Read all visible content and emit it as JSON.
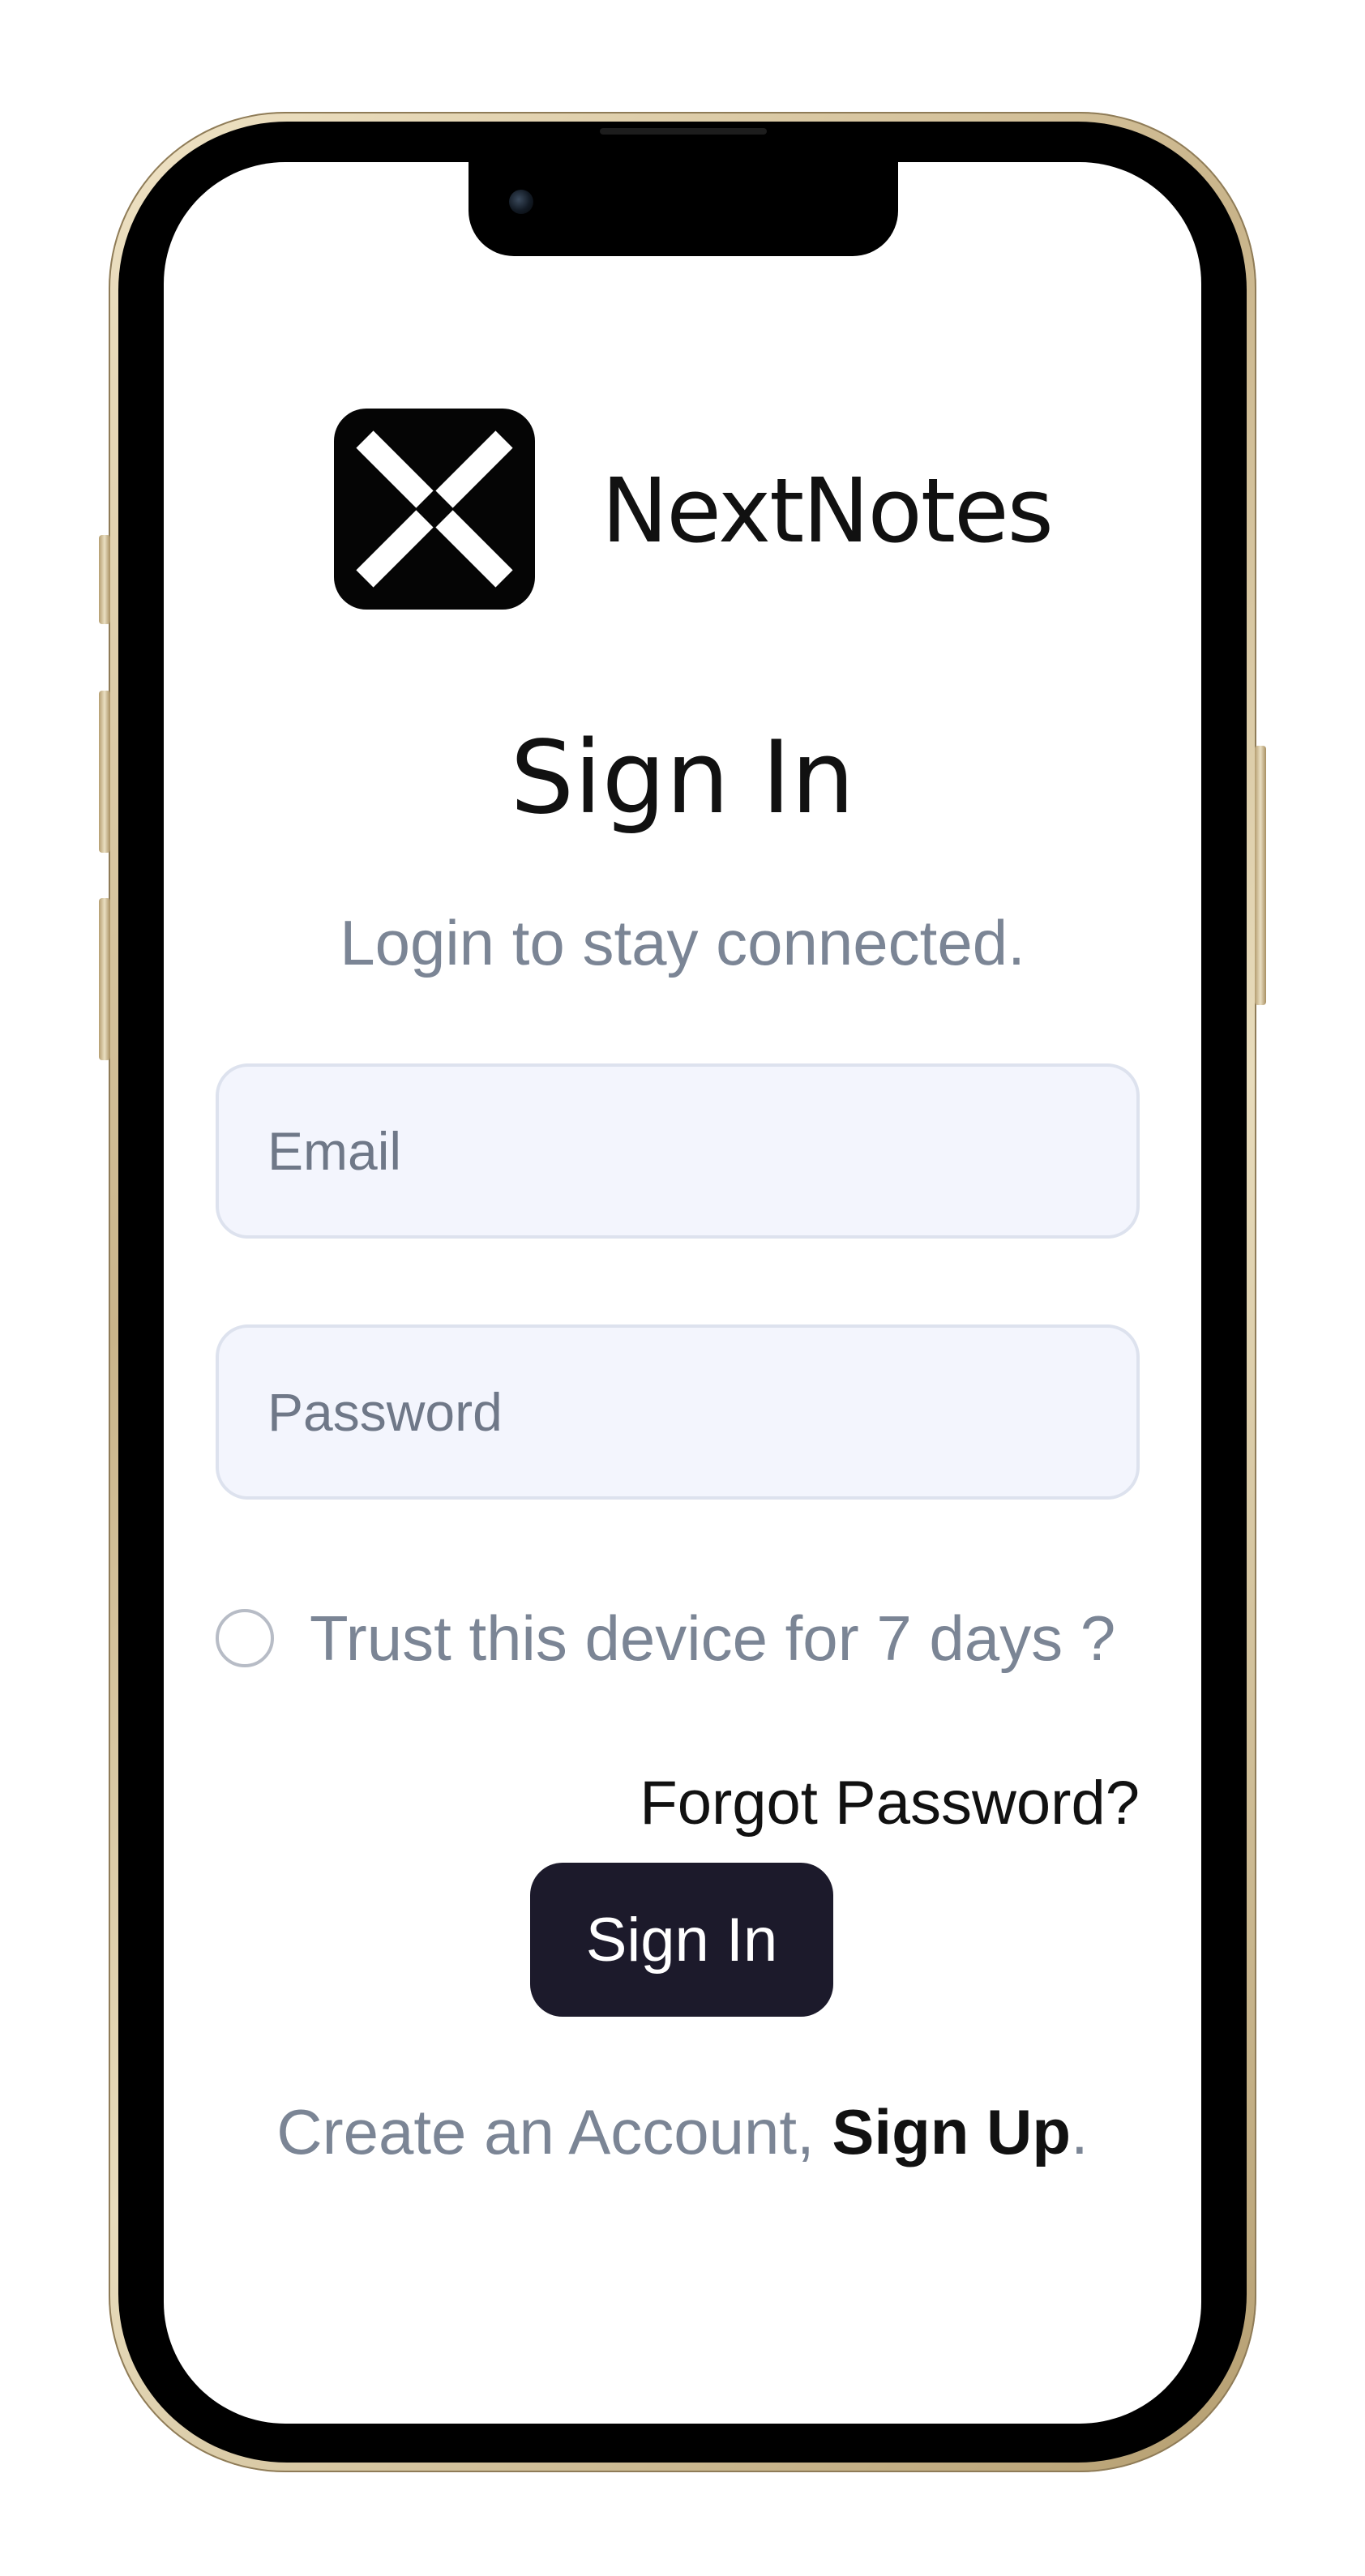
{
  "brand": {
    "name": "NextNotes",
    "logo_icon": "x-cross-logo"
  },
  "page": {
    "title": "Sign In",
    "subtitle": "Login to stay connected."
  },
  "form": {
    "email_placeholder": "Email",
    "password_placeholder": "Password",
    "remember_label": "Trust this device for 7 days ?",
    "forgot_label": "Forgot Password?",
    "submit_label": "Sign In"
  },
  "footer": {
    "prompt": "Create an Account, ",
    "signup_label": "Sign Up",
    "suffix": "."
  },
  "colors": {
    "button_bg": "#1c1a2b",
    "muted_text": "#7b8595",
    "input_bg": "#f3f5fd"
  }
}
